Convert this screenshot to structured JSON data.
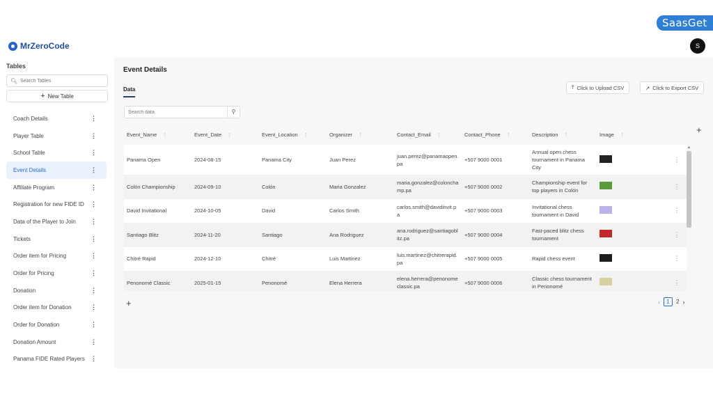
{
  "watermark": "SaasGet",
  "brand": {
    "name": "MrZeroCode"
  },
  "user": {
    "avatar_initial": "S"
  },
  "sidebar": {
    "title": "Tables",
    "search_placeholder": "Search Tables",
    "new_table_label": "New Table",
    "items": [
      {
        "label": "Coach Details",
        "active": false
      },
      {
        "label": "Player Table",
        "active": false
      },
      {
        "label": "School Table",
        "active": false
      },
      {
        "label": "Event Details",
        "active": true
      },
      {
        "label": "Affiliate Program",
        "active": false
      },
      {
        "label": "Registration for new FIDE ID",
        "active": false
      },
      {
        "label": "Data of the Player to Join",
        "active": false
      },
      {
        "label": "Tickets",
        "active": false
      },
      {
        "label": "Order item for Pricing",
        "active": false
      },
      {
        "label": "Order for Pricing",
        "active": false
      },
      {
        "label": "Donation",
        "active": false
      },
      {
        "label": "Order item for Donation",
        "active": false
      },
      {
        "label": "Order for Donation",
        "active": false
      },
      {
        "label": "Donation Amount",
        "active": false
      },
      {
        "label": "Panama FIDE Rated Players",
        "active": false
      }
    ]
  },
  "main": {
    "title": "Event Details",
    "tab": "Data",
    "upload_label": "Click to Upload CSV",
    "export_label": "Click to Export CSV",
    "search_placeholder": "Search data"
  },
  "table": {
    "columns": [
      "Event_Name",
      "Event_Date",
      "Event_Location",
      "Organizer",
      "Contact_Email",
      "Contact_Phone",
      "Description",
      "Image"
    ],
    "rows": [
      {
        "cells": [
          "Panama Open",
          "2024-08-15",
          "Panama City",
          "Juan Perez",
          "juan.perez@panamaopen.pa",
          "+507 9000 0001",
          "Annual open chess tournament in Panama City"
        ],
        "thumb": "#222222"
      },
      {
        "cells": [
          "Colón Championship",
          "2024-09-10",
          "Colón",
          "Maria Gonzalez",
          "maria.gonzalez@colonchamp.pa",
          "+507 9000 0002",
          "Championship event for top players in Colón"
        ],
        "thumb": "#5a9a3a"
      },
      {
        "cells": [
          "David Invitational",
          "2024-10-05",
          "David",
          "Carlos Smith",
          "carlos.smith@davidinvit.pa",
          "+507 9000 0003",
          "Invitational chess tournament in David"
        ],
        "thumb": "#b9b3ea"
      },
      {
        "cells": [
          "Santiago Blitz",
          "2024-11-20",
          "Santiago",
          "Ana Rodriguez",
          "ana.rodriguez@santiagoblitz.pa",
          "+507 9000 0004",
          "Fast-paced blitz chess tournament"
        ],
        "thumb": "#c22a2a"
      },
      {
        "cells": [
          "Chitré Rapid",
          "2024-12-10",
          "Chitré",
          "Luis Martinez",
          "luis.martinez@chitrerapid.pa",
          "+507 9000 0005",
          "Rapid chess event"
        ],
        "thumb": "#1e1e1e"
      },
      {
        "cells": [
          "Penonomé Classic",
          "2025-01-15",
          "Penonomé",
          "Elena Herrera",
          "elena.herrera@penonomeclassic.pa",
          "+507 9000 0006",
          "Classic chess tournament in Penonomé"
        ],
        "thumb": "#d8d0a0"
      }
    ]
  },
  "pagination": {
    "current": "1",
    "next_page": "2"
  }
}
